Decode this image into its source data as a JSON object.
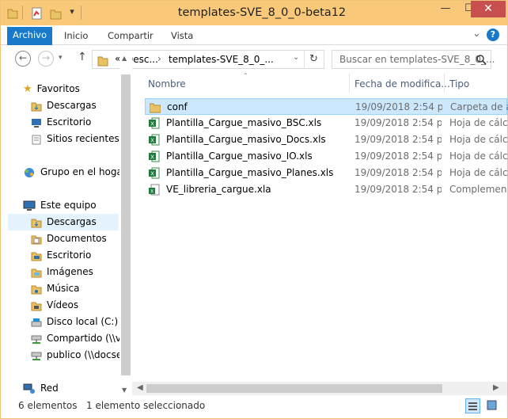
{
  "window": {
    "title": "templates-SVE_8_0_0-beta12",
    "minimize": "—",
    "maximize": "☐",
    "close": "✕"
  },
  "ribbon": {
    "tabs": [
      "Archivo",
      "Inicio",
      "Compartir",
      "Vista"
    ],
    "help": "?",
    "expand": "⌄"
  },
  "address": {
    "prefix": "«",
    "crumb1": "Desc...",
    "sep": "›",
    "crumb2": "templates-SVE_8_0_...",
    "search_placeholder": "Buscar en templates-SVE_8_0_..."
  },
  "nav": {
    "favorites": "Favoritos",
    "fav_items": [
      "Descargas",
      "Escritorio",
      "Sitios recientes"
    ],
    "homegroup": "Grupo en el hogar",
    "pc": "Este equipo",
    "pc_items": [
      "Descargas",
      "Documentos",
      "Escritorio",
      "Imágenes",
      "Música",
      "Vídeos",
      "Disco local (C:)",
      "Compartido (\\\\vl",
      "publico (\\\\docse"
    ],
    "network": "Red"
  },
  "columns": {
    "name": "Nombre",
    "date": "Fecha de modifica...",
    "type": "Tipo"
  },
  "files": [
    {
      "name": "conf",
      "date": "19/09/2018 2:54 p....",
      "type": "Carpeta de a",
      "kind": "folder",
      "selected": true
    },
    {
      "name": "Plantilla_Cargue_masivo_BSC.xls",
      "date": "19/09/2018 2:54 p....",
      "type": "Hoja de cálc",
      "kind": "xls",
      "selected": false
    },
    {
      "name": "Plantilla_Cargue_masivo_Docs.xls",
      "date": "19/09/2018 2:54 p....",
      "type": "Hoja de cálc",
      "kind": "xls",
      "selected": false
    },
    {
      "name": "Plantilla_Cargue_masivo_IO.xls",
      "date": "19/09/2018 2:54 p....",
      "type": "Hoja de cálc",
      "kind": "xls",
      "selected": false
    },
    {
      "name": "Plantilla_Cargue_masivo_Planes.xls",
      "date": "19/09/2018 2:54 p....",
      "type": "Hoja de cálc",
      "kind": "xls",
      "selected": false
    },
    {
      "name": "VE_libreria_cargue.xla",
      "date": "19/09/2018 2:54 p....",
      "type": "Complemen",
      "kind": "xla",
      "selected": false
    }
  ],
  "status": {
    "count": "6 elementos",
    "selection": "1 elemento seleccionado"
  },
  "colors": {
    "titlebar": "#f9c879",
    "accent": "#1979ca",
    "selection": "#cce8ff",
    "close": "#c7504f"
  }
}
